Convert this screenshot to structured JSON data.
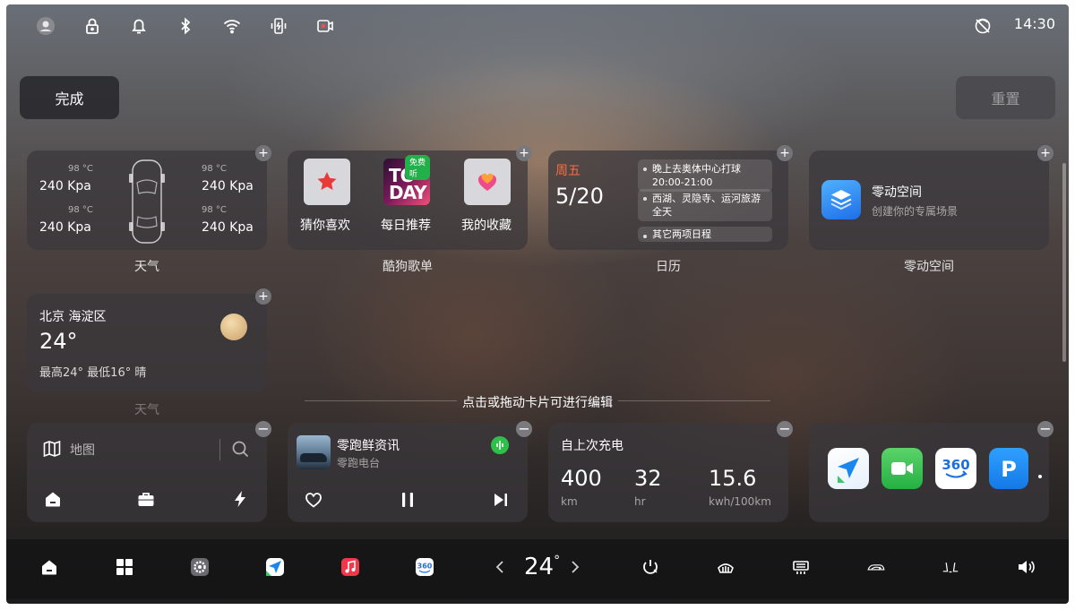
{
  "status_bar": {
    "time": "14:30",
    "icons": [
      "avatar-icon",
      "lock-icon",
      "bell-icon",
      "bluetooth-icon",
      "wifi-icon",
      "phone-charging-icon",
      "camera-record-icon",
      "signal-off-icon"
    ]
  },
  "header": {
    "done_label": "完成",
    "reset_label": "重置"
  },
  "tire_card": {
    "label": "天气",
    "tires": [
      {
        "temp": "98 °C",
        "pressure": "240 Kpa"
      },
      {
        "temp": "98 °C",
        "pressure": "240 Kpa"
      },
      {
        "temp": "98 °C",
        "pressure": "240 Kpa"
      },
      {
        "temp": "98 °C",
        "pressure": "240 Kpa"
      }
    ]
  },
  "music_card": {
    "label": "酷狗歌单",
    "items": [
      {
        "name": "猜你喜欢"
      },
      {
        "name": "每日推荐",
        "badge": "免费听",
        "cover_text": "TODAY"
      },
      {
        "name": "我的收藏"
      }
    ]
  },
  "calendar_card": {
    "label": "日历",
    "weekday": "周五",
    "date": "5/20",
    "events": [
      {
        "title": "晚上去奥体中心打球",
        "time": "20:00-21:00"
      },
      {
        "title": "西湖、灵隐寺、运河旅游",
        "time": "全天"
      },
      {
        "title": "其它两项日程",
        "time": ""
      }
    ]
  },
  "space_card": {
    "label": "零动空间",
    "title": "零动空间",
    "subtitle": "创建你的专属场景"
  },
  "weather_card": {
    "label": "天气",
    "location": "北京  海淀区",
    "temp": "24°",
    "summary": "最高24°  最低16°  晴"
  },
  "edit_hint": "点击或拖动卡片可进行编辑",
  "map_card": {
    "label": "地图"
  },
  "radio_card": {
    "title": "零跑鲜资讯",
    "subtitle": "零跑电台"
  },
  "charge_card": {
    "title": "自上次充电",
    "stats": [
      {
        "value": "400",
        "unit": "km"
      },
      {
        "value": "32",
        "unit": "hr"
      },
      {
        "value": "15.6",
        "unit": "kwh/100km"
      }
    ]
  },
  "apps_card": {
    "apps": [
      "navigation-app-icon",
      "facetime-app-icon",
      "360-camera-app-icon",
      "parking-app-icon"
    ]
  },
  "dock": {
    "climate_temp": "24",
    "degree": "°"
  },
  "colors": {
    "accent_orange": "#ff6a3d",
    "space_blue": "#2d7ef0",
    "green": "#2ec14a"
  }
}
